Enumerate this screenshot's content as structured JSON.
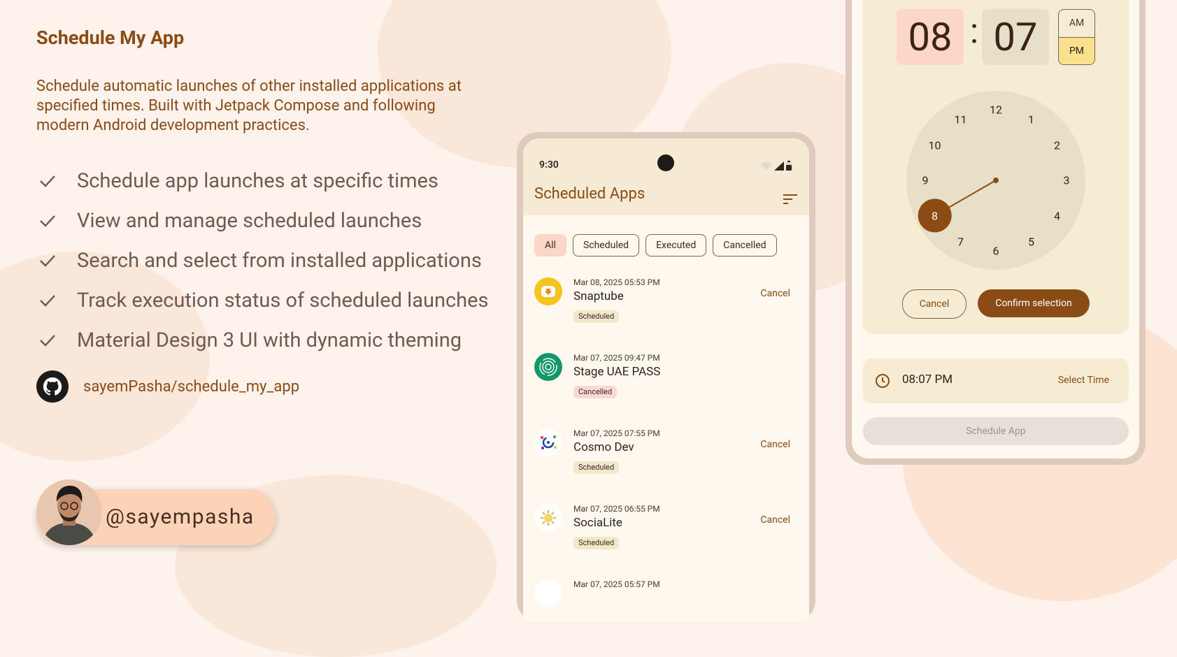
{
  "info": {
    "title": "Schedule My App",
    "description": "Schedule automatic launches of other installed applications at specified times. Built with Jetpack Compose and following modern Android development practices.",
    "features": [
      "Schedule app launches at specific times",
      "View and manage scheduled launches",
      "Search and select from installed applications",
      "Track execution status of scheduled launches",
      "Material Design 3 UI with dynamic theming"
    ],
    "repo": "sayemPasha/schedule_my_app",
    "handle": "@sayempasha"
  },
  "list_screen": {
    "status_time": "9:30",
    "title": "Scheduled Apps",
    "filters": [
      "All",
      "Scheduled",
      "Executed",
      "Cancelled"
    ],
    "active_filter": "All",
    "items": [
      {
        "date": "Mar 08, 2025 05:53 PM",
        "name": "Snaptube",
        "status": "Scheduled",
        "action": "Cancel",
        "icon": "snaptube-icon"
      },
      {
        "date": "Mar 07, 2025 09:47 PM",
        "name": "Stage UAE PASS",
        "status": "Cancelled",
        "action": "",
        "icon": "uae-pass-icon"
      },
      {
        "date": "Mar 07, 2025 07:55 PM",
        "name": "Cosmo Dev",
        "status": "Scheduled",
        "action": "Cancel",
        "icon": "cosmo-dev-icon"
      },
      {
        "date": "Mar 07, 2025 06:55 PM",
        "name": "SociaLite",
        "status": "Scheduled",
        "action": "Cancel",
        "icon": "socialite-icon"
      },
      {
        "date": "Mar 07, 2025 05:57 PM",
        "name": "",
        "status": "",
        "action": "",
        "icon": "app-icon"
      }
    ]
  },
  "time_picker": {
    "hour": "08",
    "minute": "07",
    "am": "AM",
    "pm": "PM",
    "period_selected": "PM",
    "dial_numbers": [
      "12",
      "1",
      "2",
      "3",
      "4",
      "5",
      "6",
      "7",
      "8",
      "9",
      "10",
      "11"
    ],
    "selected_hour": "8",
    "cancel_label": "Cancel",
    "confirm_label": "Confirm selection",
    "selected_time": "08:07 PM",
    "select_time_label": "Select Time",
    "schedule_label": "Schedule App"
  },
  "colors": {
    "background": "#fdf3ec",
    "accent": "#8a4b14",
    "chip_active": "#fcd6c6",
    "badge_scheduled": "#f1e7c9",
    "badge_cancelled": "#fbd8d3",
    "pm_selected": "#f8e08c"
  }
}
